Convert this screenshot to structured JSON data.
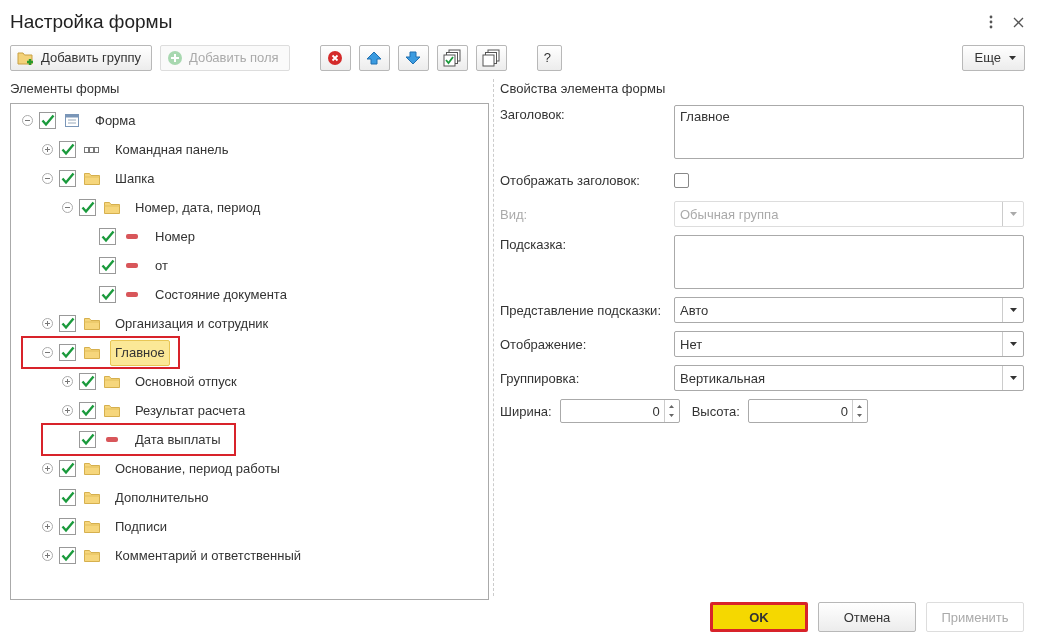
{
  "window": {
    "title": "Настройка формы"
  },
  "toolbar": [
    {
      "kind": "text",
      "label": "Добавить группу",
      "disabled": false
    },
    {
      "kind": "text",
      "label": "Добавить поля",
      "disabled": true
    },
    {
      "kind": "icon",
      "disabled": false
    },
    {
      "kind": "icon",
      "disabled": false
    },
    {
      "kind": "icon",
      "disabled": false
    },
    {
      "kind": "icon",
      "disabled": false
    },
    {
      "kind": "icon",
      "disabled": false
    },
    {
      "kind": "text",
      "label": "?",
      "disabled": false
    }
  ],
  "more_button": {
    "label": "Еще"
  },
  "tree": {
    "title": "Элементы формы",
    "nodes": [
      {
        "label": "Форма",
        "kind": "form",
        "expanded": true,
        "checked": true,
        "selected": false,
        "highlighted": false,
        "children": [
          {
            "label": "Командная панель",
            "kind": "panel",
            "expanded": false,
            "checked": true,
            "selected": false,
            "highlighted": false
          },
          {
            "label": "Шапка",
            "kind": "folder",
            "expanded": true,
            "checked": true,
            "selected": false,
            "highlighted": false,
            "children": [
              {
                "label": "Номер, дата, период",
                "kind": "folder",
                "expanded": true,
                "checked": true,
                "selected": false,
                "highlighted": false,
                "children": [
                  {
                    "label": "Номер",
                    "kind": "field",
                    "checked": true,
                    "selected": false,
                    "highlighted": false
                  },
                  {
                    "label": "от",
                    "kind": "field",
                    "checked": true,
                    "selected": false,
                    "highlighted": false
                  },
                  {
                    "label": "Состояние документа",
                    "kind": "field",
                    "checked": true,
                    "selected": false,
                    "highlighted": false
                  }
                ]
              }
            ]
          },
          {
            "label": "Организация и сотрудник",
            "kind": "folder",
            "expanded": false,
            "checked": true,
            "selected": false,
            "highlighted": false
          },
          {
            "label": "Главное",
            "kind": "folder",
            "expanded": true,
            "checked": true,
            "selected": true,
            "highlighted": true,
            "children": [
              {
                "label": "Основной отпуск",
                "kind": "folder",
                "expanded": false,
                "checked": true,
                "selected": false,
                "highlighted": false
              },
              {
                "label": "Результат расчета",
                "kind": "folder",
                "expanded": false,
                "checked": true,
                "selected": false,
                "highlighted": false
              },
              {
                "label": "Дата выплаты",
                "kind": "field",
                "checked": true,
                "selected": false,
                "highlighted": true
              }
            ]
          },
          {
            "label": "Основание, период работы",
            "kind": "folder",
            "expanded": false,
            "checked": true,
            "selected": false,
            "highlighted": false
          },
          {
            "label": "Дополнительно",
            "kind": "folder",
            "checked": true,
            "selected": false,
            "highlighted": false
          },
          {
            "label": "Подписи",
            "kind": "folder",
            "expanded": false,
            "checked": true,
            "selected": false,
            "highlighted": false
          },
          {
            "label": "Комментарий и ответственный",
            "kind": "folder",
            "expanded": false,
            "checked": true,
            "selected": false,
            "highlighted": false
          }
        ]
      }
    ]
  },
  "properties": {
    "title": "Свойства элемента формы",
    "fields": [
      {
        "kind": "textarea",
        "label": "Заголовок:",
        "value": "Главное"
      },
      {
        "kind": "checkbox",
        "label": "Отображать заголовок:",
        "checked": false
      },
      {
        "kind": "select",
        "label": "Вид:",
        "value": "Обычная группа",
        "disabled": true
      },
      {
        "kind": "textarea",
        "label": "Подсказка:"
      },
      {
        "kind": "select",
        "label": "Представление подсказки:",
        "value": "Авто",
        "disabled": false
      },
      {
        "kind": "select",
        "label": "Отображение:",
        "value": "Нет",
        "disabled": false
      },
      {
        "kind": "select",
        "label": "Группировка:",
        "value": "Вертикальная",
        "disabled": false
      }
    ],
    "size": [
      {
        "label": "Ширина:",
        "value": "0"
      },
      {
        "label": "Высота:",
        "value": "0"
      }
    ]
  },
  "footer": [
    {
      "label": "OK",
      "default": true,
      "highlighted": true,
      "disabled": false
    },
    {
      "label": "Отмена",
      "default": false,
      "highlighted": false,
      "disabled": false
    },
    {
      "label": "Применить",
      "default": false,
      "highlighted": false,
      "disabled": true
    }
  ]
}
